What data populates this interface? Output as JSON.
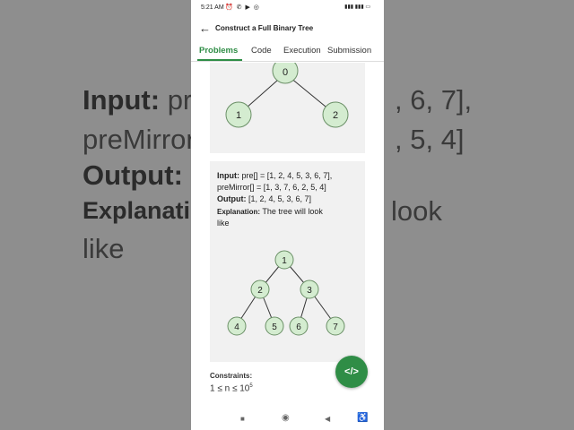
{
  "background": {
    "line1_bold": "Input:",
    "line1_rest": " pre",
    "line1_tail": ", 6, 7],",
    "line2": "preMirror",
    "line2_tail": ", 5, 4]",
    "line3_bold": "Output: [",
    "line4_bold": "Explanation",
    "line4_tail": "look",
    "line5": "like"
  },
  "status_bar": {
    "time": "5:21 AM",
    "left_icons": "⏰ ✆ ▶ ◎",
    "right_icons": "▮▮▮ ▮▮▮ ▭"
  },
  "app_bar": {
    "title": "Construct a Full Binary Tree",
    "back_icon": "arrow-left-icon"
  },
  "tabs": [
    {
      "label": "Problems",
      "active": true
    },
    {
      "label": "Code",
      "active": false
    },
    {
      "label": "Execution",
      "active": false
    },
    {
      "label": "Submission",
      "active": false
    }
  ],
  "tree1": {
    "nodes": [
      "0",
      "1",
      "2"
    ]
  },
  "example": {
    "input_label": "Input:",
    "input_line1": " pre[] = [1, 2, 4, 5, 3, 6, 7],",
    "input_line2": "preMirror[] = [1, 3, 7, 6, 2, 5, 4]",
    "output_label": "Output:",
    "output_value": " [1, 2, 4, 5, 3, 6, 7]",
    "explanation_label": "Explanation:",
    "explanation_line1": " The tree will look",
    "explanation_line2": "like"
  },
  "tree2": {
    "nodes": [
      "1",
      "2",
      "3",
      "4",
      "5",
      "6",
      "7"
    ]
  },
  "constraints": {
    "label": "Constraints:",
    "text": "1 ≤ n ≤ 10",
    "exponent": "5"
  },
  "fab": {
    "label": "</>"
  },
  "navbar": {
    "items": [
      "■",
      "◉",
      "◀",
      "♿"
    ]
  },
  "colors": {
    "accent": "#2f8d46",
    "node_fill": "#d4ecd0",
    "node_stroke": "#6a8f66"
  }
}
